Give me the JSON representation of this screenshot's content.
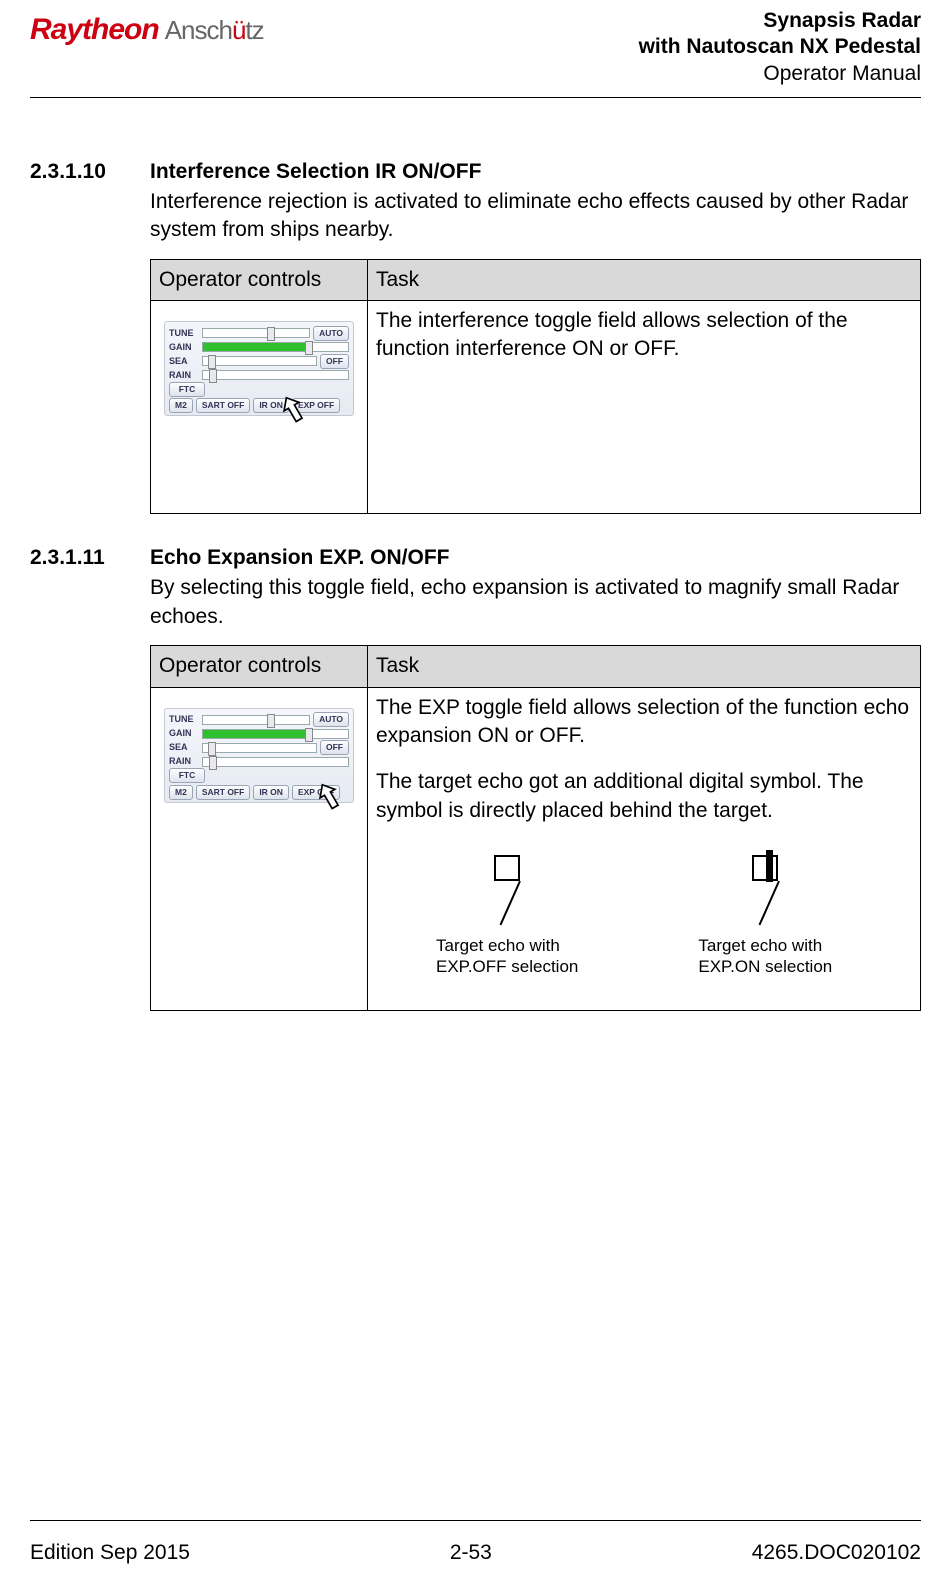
{
  "header": {
    "logo_main": "Raytheon",
    "logo_sub_plain": "Ansch",
    "logo_sub_accent": "ü",
    "logo_sub_tail": "tz",
    "title_line1": "Synapsis Radar",
    "title_line2": "with Nautoscan NX Pedestal",
    "title_line3": "Operator Manual"
  },
  "sections": [
    {
      "num": "2.3.1.10",
      "heading": "Interference Selection IR ON/OFF",
      "para": "Interference rejection is activated to eliminate echo effects caused by other Radar system from ships nearby.",
      "table": {
        "col1": "Operator controls",
        "col2": "Task",
        "task": "The interference toggle field allows selection of the function interference ON or OFF."
      }
    },
    {
      "num": "2.3.1.11",
      "heading": "Echo Expansion EXP. ON/OFF",
      "para": "By selecting this toggle field, echo expansion is activated to magnify small Radar echoes.",
      "table": {
        "col1": "Operator controls",
        "col2": "Task",
        "task_p1": "The EXP toggle field allows selection of the function echo expansion ON or OFF.",
        "task_p2": "The target echo got an additional digital symbol. The symbol is directly placed behind the target.",
        "echo_off_label": "Target echo with\nEXP.OFF selection",
        "echo_on_label": "Target echo with\nEXP.ON selection"
      }
    }
  ],
  "panel": {
    "tune": "TUNE",
    "gain": "GAIN",
    "sea": "SEA",
    "rain": "RAIN",
    "ftc": "FTC",
    "auto": "AUTO",
    "off": "OFF",
    "m2": "M2",
    "sart_off": "SART OFF",
    "ir_on": "IR ON",
    "exp_off": "EXP OFF"
  },
  "footer": {
    "left": "Edition Sep 2015",
    "center": "2-53",
    "right": "4265.DOC020102"
  }
}
